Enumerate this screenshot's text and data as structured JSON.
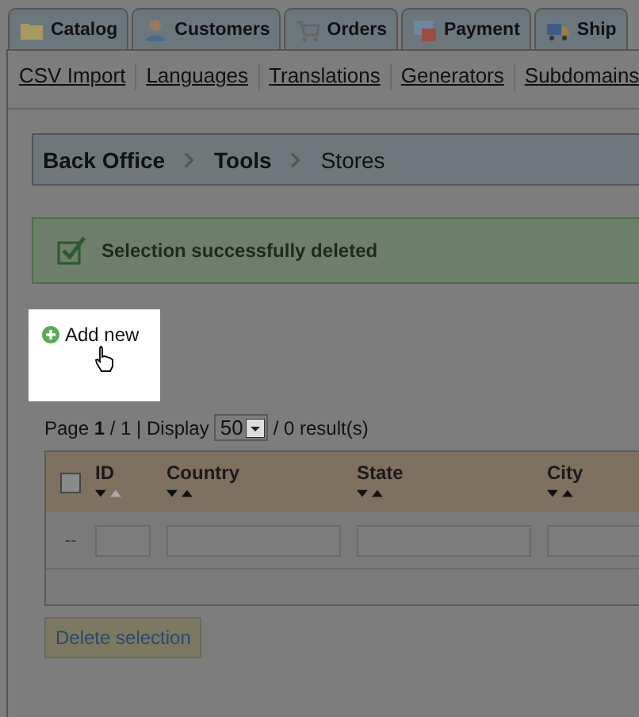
{
  "tabs": [
    {
      "label": "Catalog",
      "kind": "catalog"
    },
    {
      "label": "Customers",
      "kind": "customers"
    },
    {
      "label": "Orders",
      "kind": "orders"
    },
    {
      "label": "Payment",
      "kind": "payment"
    },
    {
      "label": "Ship",
      "kind": "shipping"
    }
  ],
  "subnav": [
    "CSV Import",
    "Languages",
    "Translations",
    "Generators",
    "Subdomains"
  ],
  "breadcrumb": [
    {
      "label": "Back Office",
      "kind": "link"
    },
    {
      "label": "Tools",
      "kind": "link"
    },
    {
      "label": "Stores",
      "kind": "current"
    }
  ],
  "message": "Selection successfully deleted",
  "add_new": "Add new",
  "pagination": {
    "text": "Page **1** / 1 | Display",
    "per_page": "50",
    "results": "/ 0 result(s)"
  },
  "table": {
    "select_all_checked": false,
    "columns": [
      {
        "label": "ID",
        "sorted": true
      },
      {
        "label": "Country",
        "sorted": false
      },
      {
        "label": "State",
        "sorted": false
      },
      {
        "label": "City",
        "sorted": false
      }
    ],
    "filter_row_mark": "--"
  },
  "delete_button": "Delete selection"
}
